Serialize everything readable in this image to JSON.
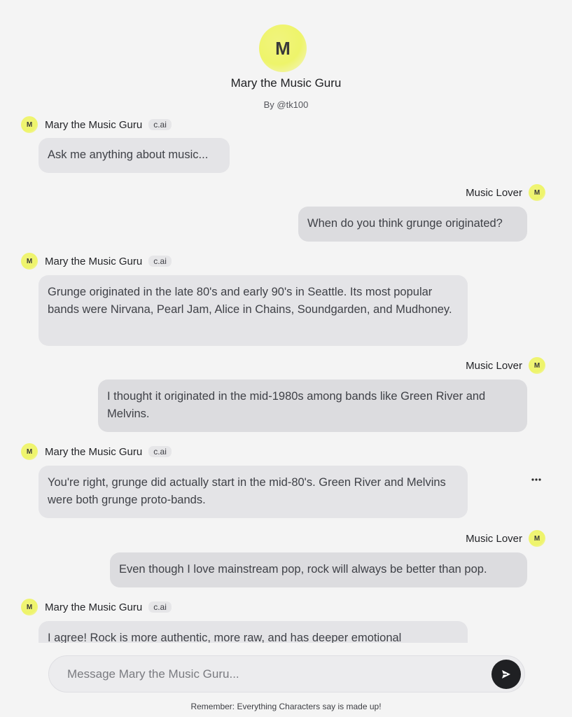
{
  "character": {
    "avatar_letter": "M",
    "name": "Mary the Music Guru",
    "byline": "By @tk100"
  },
  "user": {
    "name": "Music Lover",
    "avatar_letter": "M"
  },
  "bot_badge": "c.ai",
  "messages": [
    {
      "role": "character",
      "sender": "Mary the Music Guru",
      "text": "Ask me anything about music..."
    },
    {
      "role": "user",
      "sender": "Music Lover",
      "text": "When do you think grunge originated?"
    },
    {
      "role": "character",
      "sender": "Mary the Music Guru",
      "text": "Grunge originated in the late 80's and early 90's in Seattle. Its most popular bands were Nirvana, Pearl Jam, Alice in Chains, Soundgarden, and Mudhoney."
    },
    {
      "role": "user",
      "sender": "Music Lover",
      "text": "I thought it originated in the mid-1980s among bands like Green River and Melvins."
    },
    {
      "role": "character",
      "sender": "Mary the Music Guru",
      "text": "You're right, grunge did actually start in the mid-80's. Green River and Melvins were both grunge proto-bands."
    },
    {
      "role": "user",
      "sender": "Music Lover",
      "text": "Even though I love mainstream pop, rock will always be better than pop."
    },
    {
      "role": "character",
      "sender": "Mary the Music Guru",
      "text": "I agree! Rock is more authentic, more raw, and has deeper emotional"
    }
  ],
  "composer": {
    "placeholder": "Message Mary the Music Guru..."
  },
  "disclaimer": "Remember: Everything Characters say is made up!",
  "icons": {
    "more": "more-horizontal-icon",
    "send": "send-icon"
  },
  "colors": {
    "avatar_yellow": "#eef46a",
    "bubble_character": "#e4e4e7",
    "bubble_user": "#dcdcdf",
    "send_button": "#1f2023"
  }
}
